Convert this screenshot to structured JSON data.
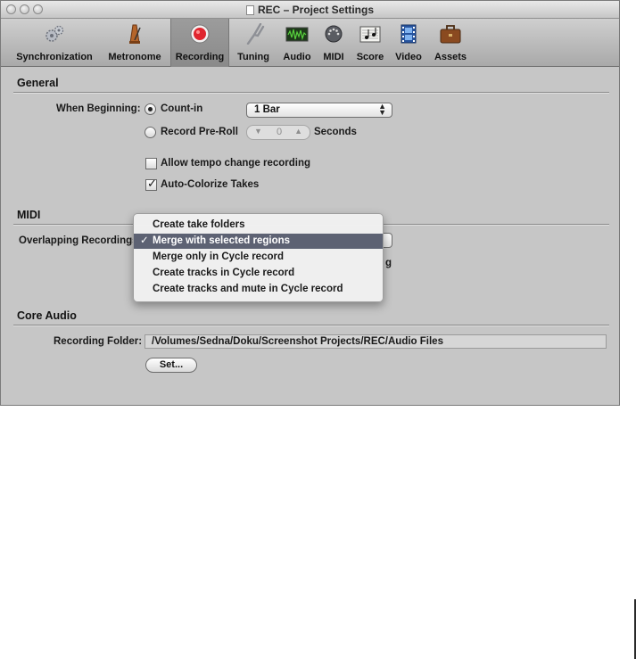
{
  "window": {
    "title": "REC – Project Settings"
  },
  "toolbar": {
    "items": [
      {
        "label": "Synchronization",
        "icon": "gears-icon"
      },
      {
        "label": "Metronome",
        "icon": "metronome-icon"
      },
      {
        "label": "Recording",
        "icon": "record-icon",
        "selected": true
      },
      {
        "label": "Tuning",
        "icon": "tuning-fork-icon"
      },
      {
        "label": "Audio",
        "icon": "audio-waveform-icon"
      },
      {
        "label": "MIDI",
        "icon": "midi-plug-icon"
      },
      {
        "label": "Score",
        "icon": "score-notes-icon"
      },
      {
        "label": "Video",
        "icon": "film-icon"
      },
      {
        "label": "Assets",
        "icon": "briefcase-icon"
      }
    ]
  },
  "general": {
    "heading": "General",
    "when_beginning_label": "When Beginning:",
    "count_in_label": "Count-in",
    "count_in_value": "1 Bar",
    "record_preroll_label": "Record Pre-Roll",
    "preroll_value": "0",
    "seconds_label": "Seconds",
    "allow_tempo_label": "Allow tempo change recording",
    "allow_tempo_checked": false,
    "auto_colorize_label": "Auto-Colorize Takes",
    "auto_colorize_checked": true
  },
  "midi": {
    "heading": "MIDI",
    "overlapping_label": "Overlapping Recordings:",
    "hidden_tail": "g",
    "menu": {
      "items": [
        "Create take folders",
        "Merge with selected regions",
        "Merge only in Cycle record",
        "Create tracks in Cycle record",
        "Create tracks and mute in Cycle record"
      ],
      "selected_index": 1,
      "checkmark": "✓"
    }
  },
  "core_audio": {
    "heading": "Core Audio",
    "recording_folder_label": "Recording Folder:",
    "recording_folder_value": "/Volumes/Sedna/Doku/Screenshot Projects/REC/Audio Files",
    "set_button": "Set..."
  },
  "colors": {
    "window_bg": "#c6c6c6",
    "menu_highlight": "#5d6273",
    "record_red": "#e0262f"
  }
}
